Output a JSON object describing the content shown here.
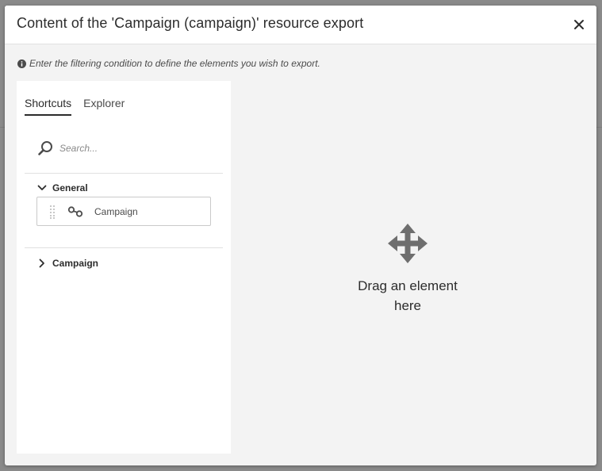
{
  "dialog": {
    "title": "Content of the 'Campaign (campaign)' resource export",
    "hint": "Enter the filtering condition to define the elements you wish to export."
  },
  "tabs": [
    {
      "label": "Shortcuts",
      "active": true
    },
    {
      "label": "Explorer",
      "active": false
    }
  ],
  "search": {
    "placeholder": "Search...",
    "value": ""
  },
  "groups": [
    {
      "label": "General",
      "expanded": true,
      "items": [
        {
          "label": "Campaign"
        }
      ]
    },
    {
      "label": "Campaign",
      "expanded": false
    }
  ],
  "drop_zone": {
    "line1": "Drag an element",
    "line2": "here"
  },
  "icons": {
    "close": "close-icon",
    "info": "info-icon",
    "search": "search-icon",
    "expand": "chevron-down-icon",
    "collapse": "chevron-right-icon",
    "drag": "drag-handle-icon",
    "link": "link-icon",
    "move": "move-icon"
  },
  "colors": {
    "backdrop": "#8a8a8a",
    "dialog_bg": "#f3f3f3",
    "panel_bg": "#ffffff",
    "text": "#2c2c2c",
    "muted": "#4b4b4b",
    "border": "#cacaca",
    "icon": "#6e6e6e"
  }
}
